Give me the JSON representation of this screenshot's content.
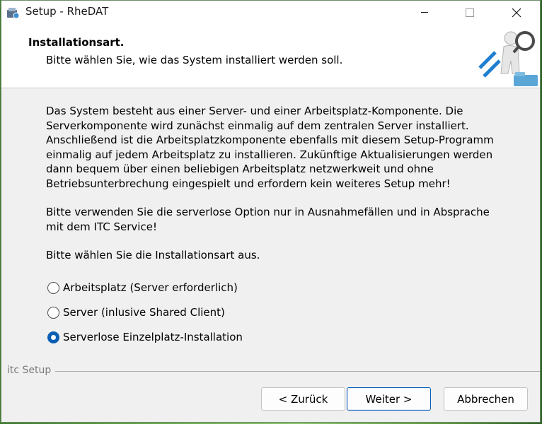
{
  "window": {
    "title": "Setup - RheDAT",
    "controls": {
      "minimize": "minimize-icon",
      "maximize": "maximize-icon",
      "close": "close-icon"
    }
  },
  "header": {
    "title": "Installationsart.",
    "subtitle": "Bitte wählen Sie, wie das System installiert werden soll."
  },
  "body": {
    "paragraphs": [
      "Das System besteht aus einer Server- und einer Arbeitsplatz-Komponente. Die Serverkomponente wird zunächst einmalig auf dem zentralen Server installiert. Anschließend ist die Arbeitsplatzkomponente ebenfalls mit diesem Setup-Programm einmalig auf jedem Arbeitsplatz zu installieren. Zukünftige Aktualisierungen werden dann bequem über einen beliebigen Arbeitsplatz netzwerkweit und ohne Betriebsunterbrechung eingespielt und erfordern kein weiteres Setup mehr!",
      "Bitte verwenden Sie die serverlose Option nur in Ausnahmefällen und in Absprache mit dem ITC Service!",
      "Bitte wählen Sie die Installationsart aus."
    ],
    "options": [
      {
        "label": "Arbeitsplatz (Server erforderlich)",
        "selected": false
      },
      {
        "label": "Server (inlusive Shared Client)",
        "selected": false
      },
      {
        "label": "Serverlose Einzelplatz-Installation",
        "selected": true
      }
    ]
  },
  "footer": {
    "brand": "itc Setup",
    "back_label": "< Zurück",
    "next_label": "Weiter >",
    "cancel_label": "Abbrechen"
  },
  "colors": {
    "accent": "#0a5fb4",
    "window_bg": "#f0f0f0",
    "header_bg": "#ffffff"
  }
}
